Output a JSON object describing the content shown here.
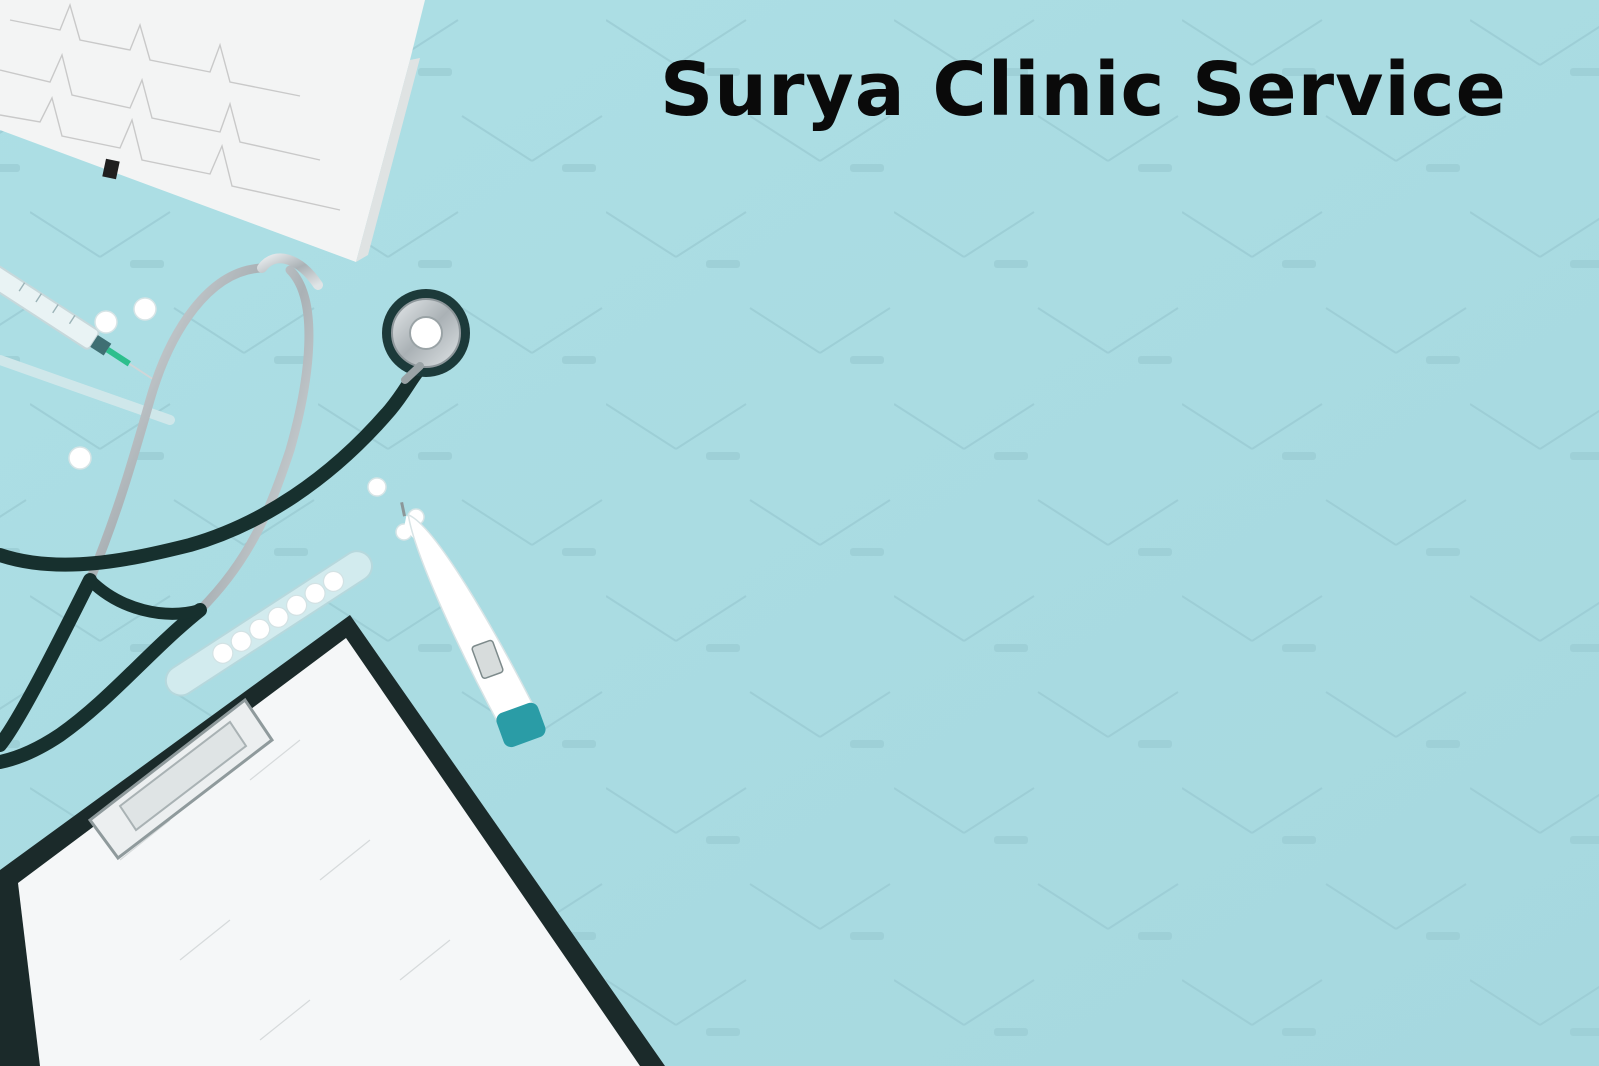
{
  "title": "Surya Clinic Service",
  "colors": {
    "background": "#a9dbe2",
    "title_text": "#0a0a0a",
    "stethoscope_tube": "#17302e",
    "stethoscope_metal": "#b7bcbf",
    "paper": "#f4f6f7",
    "clipboard": "#1b2a2a",
    "thermometer_tip": "#2a9ca6",
    "pill": "#ffffff"
  },
  "objects": [
    {
      "name": "ecg-paper",
      "kind": "ecg chart strip"
    },
    {
      "name": "syringe",
      "kind": "syringe"
    },
    {
      "name": "stethoscope",
      "kind": "stethoscope"
    },
    {
      "name": "pills",
      "kind": "white tablets"
    },
    {
      "name": "pill-tube",
      "kind": "glass tube with tablets"
    },
    {
      "name": "thermometer",
      "kind": "digital thermometer"
    },
    {
      "name": "clipboard",
      "kind": "clipboard with blank paper"
    }
  ]
}
